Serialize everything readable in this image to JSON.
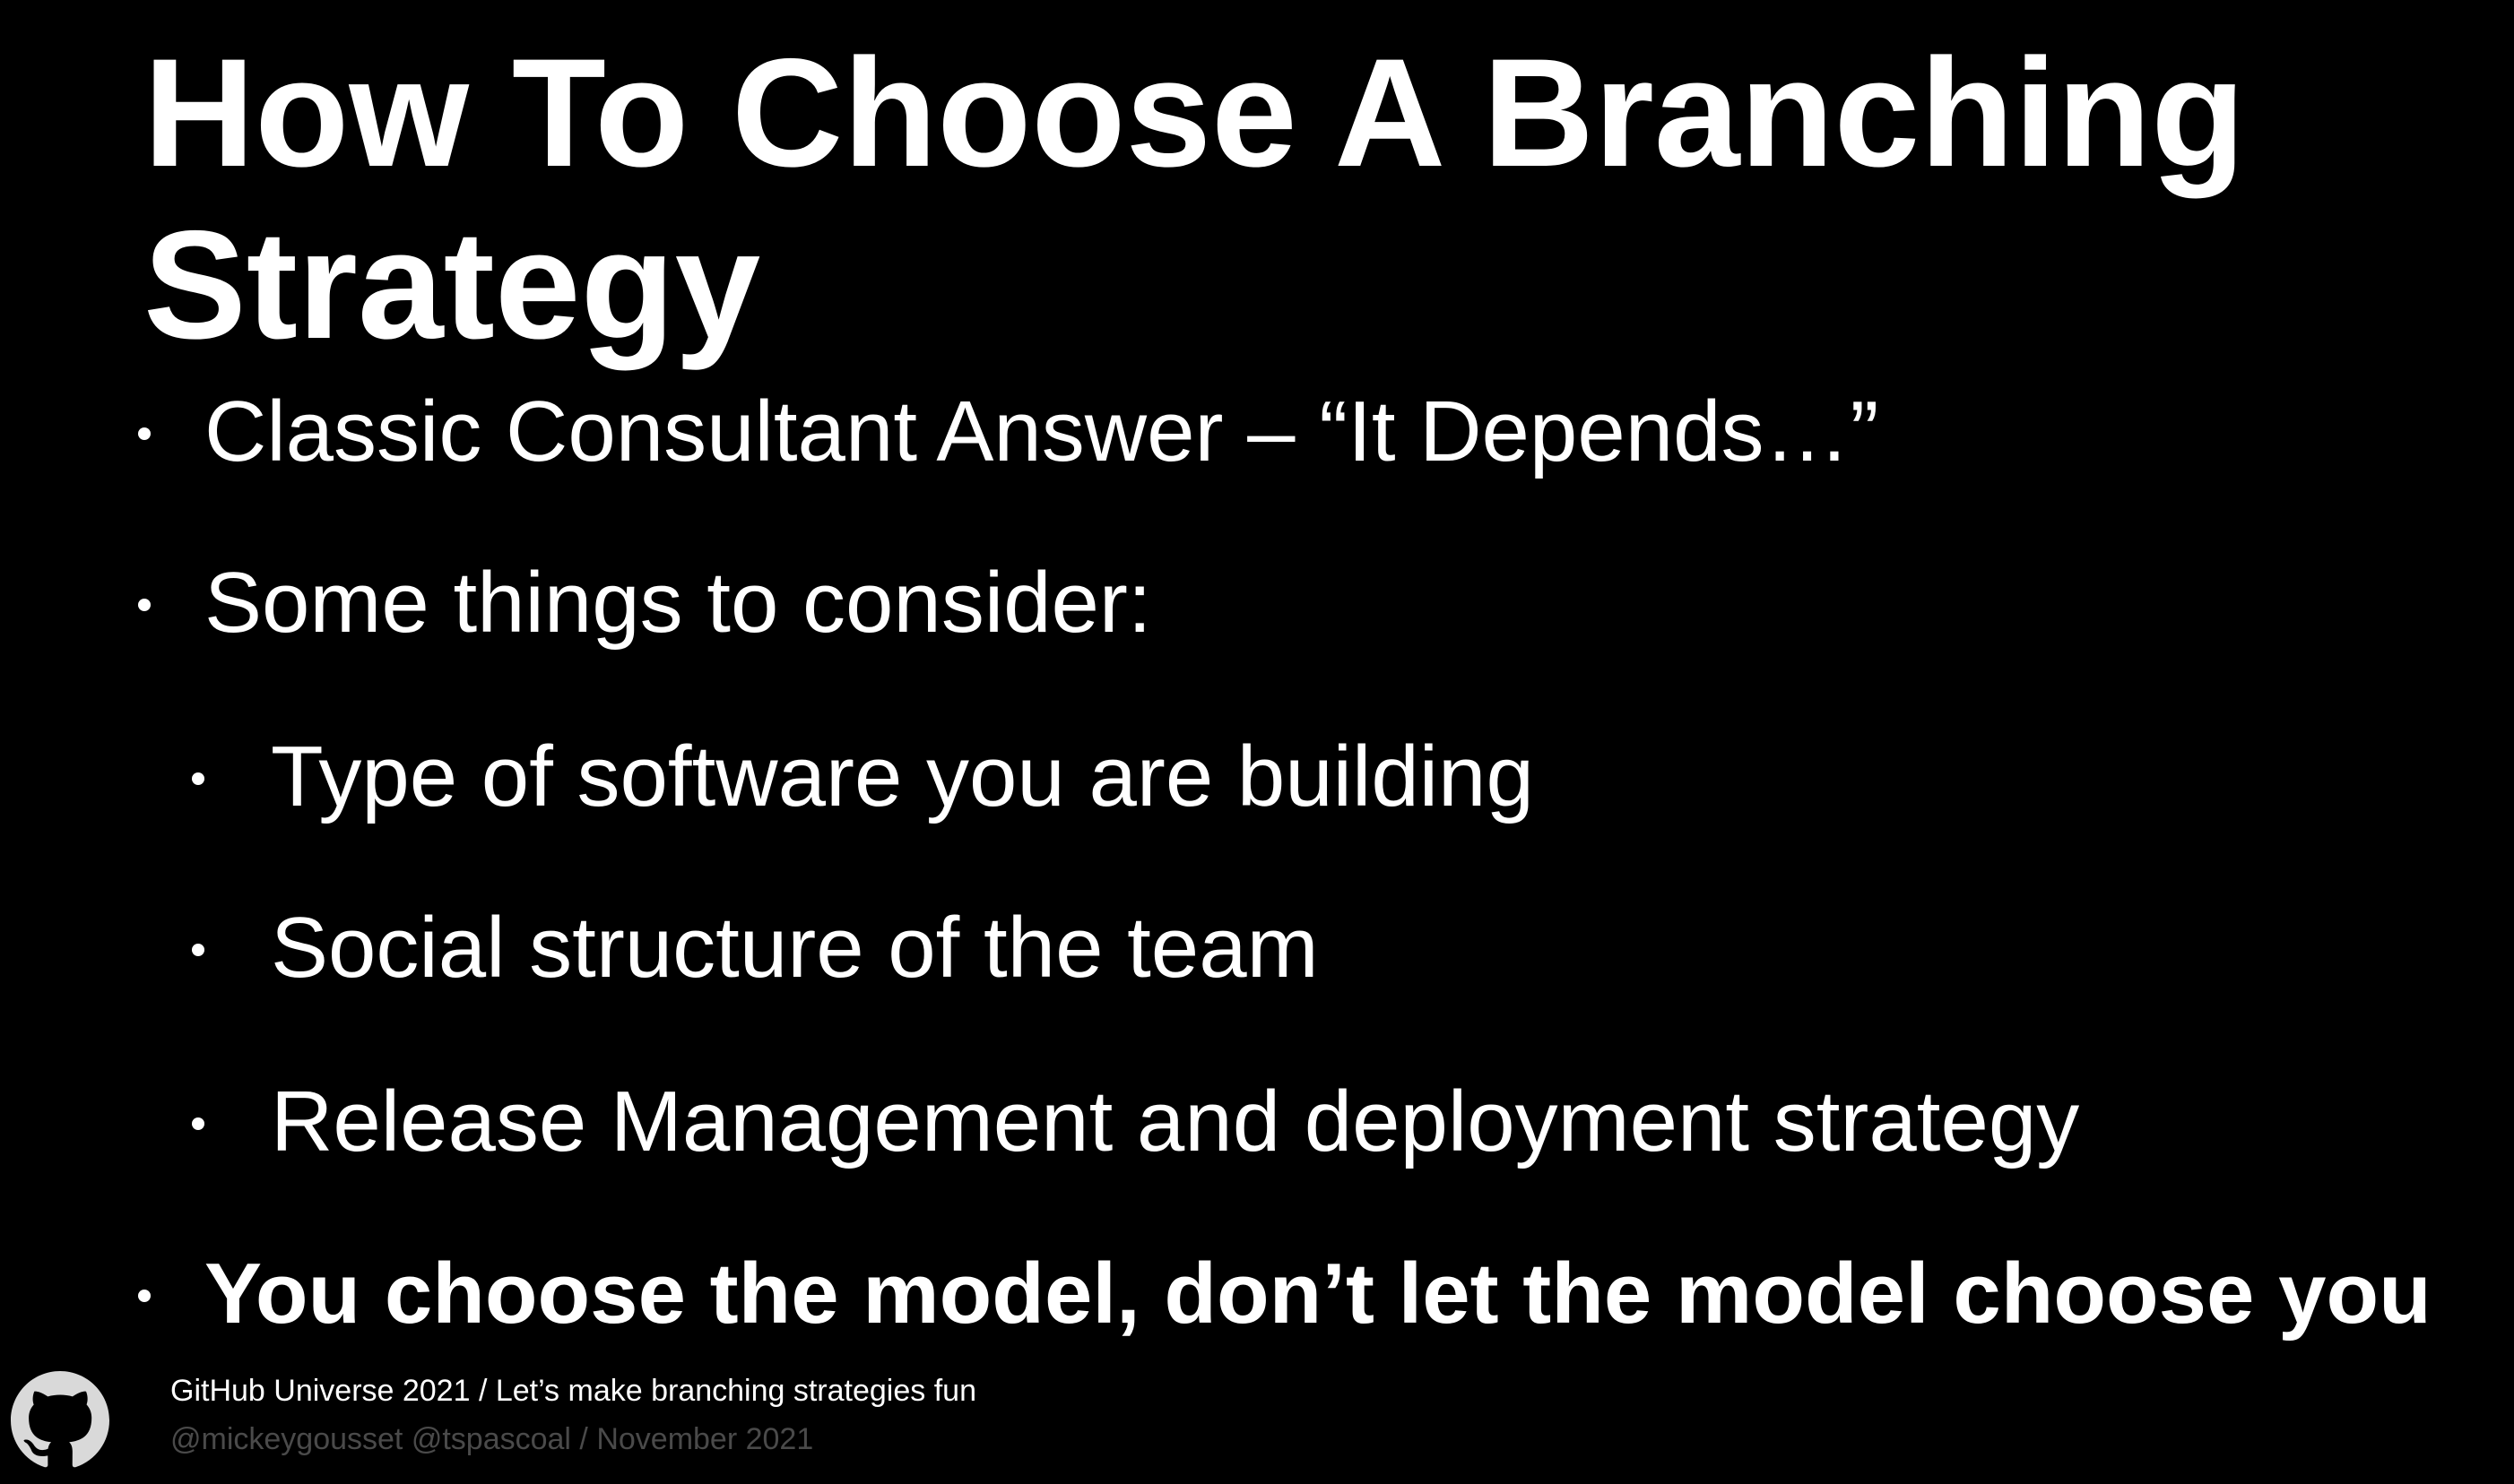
{
  "slide": {
    "title": "How To Choose A Branching Strategy",
    "bullets": [
      {
        "level": 1,
        "text": "Classic Consultant Answer – “It Depends…”",
        "bold": false
      },
      {
        "level": 1,
        "text": "Some things to consider:",
        "bold": false
      },
      {
        "level": 2,
        "text": "Type of software you are building",
        "bold": false
      },
      {
        "level": 2,
        "text": "Social structure of the team",
        "bold": false
      },
      {
        "level": 2,
        "text": "Release Management and deployment strategy",
        "bold": false
      },
      {
        "level": 1,
        "text": "You choose the model, don’t let the model choose you",
        "bold": true
      }
    ]
  },
  "footer": {
    "logo_icon": "github-octocat-icon",
    "line1": "GitHub Universe 2021 / Let’s make branching strategies fun",
    "line2": "@mickeygousset @tspascoal / November 2021"
  },
  "colors": {
    "background": "#000000",
    "text": "#ffffff",
    "footer_muted": "#4a4a4a",
    "logo": "#d9d9d9"
  }
}
